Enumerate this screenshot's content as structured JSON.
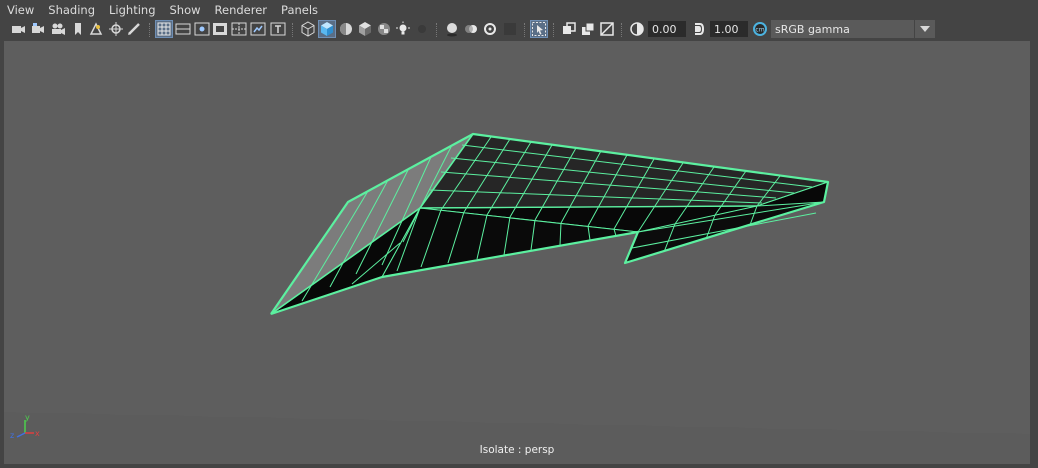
{
  "menu": {
    "items": [
      {
        "name": "menu-view",
        "label": "View"
      },
      {
        "name": "menu-shading",
        "label": "Shading"
      },
      {
        "name": "menu-lighting",
        "label": "Lighting"
      },
      {
        "name": "menu-show",
        "label": "Show"
      },
      {
        "name": "menu-renderer",
        "label": "Renderer"
      },
      {
        "name": "menu-panels",
        "label": "Panels"
      }
    ]
  },
  "toolbar": {
    "exposure_value": "0.00",
    "gamma_value": "1.00",
    "colorspace": "sRGB gamma",
    "icons": [
      "camera-icon",
      "camera-attributes-icon",
      "film-camera-icon",
      "bookmark-icon",
      "image-plane-icon",
      "pivot-icon",
      "grease-pencil-icon",
      "grid-icon",
      "film-gate-icon",
      "resolution-gate-icon",
      "gate-mask-icon",
      "field-chart-icon",
      "safe-action-icon",
      "safe-title-icon",
      "wireframe-icon",
      "smooth-shade-icon",
      "default-material-icon",
      "textured-icon",
      "checker-icon",
      "use-lights-icon",
      "shadows-icon",
      "screen-space-ao-icon",
      "motion-blur-icon",
      "multisample-aa-icon",
      "depth-of-field-icon",
      "isolate-select-icon",
      "xray-icon",
      "xray-joints-icon",
      "xray-components-icon",
      "exposure-icon",
      "gamma-icon",
      "color-management-icon",
      "chevron-down-icon"
    ]
  },
  "viewport": {
    "camera_label": "Isolate : persp",
    "axis_labels": {
      "x": "x",
      "y": "y",
      "z": "z"
    },
    "wireframe_color": "#5cf0a0",
    "background_color": "#5e5e5e"
  }
}
